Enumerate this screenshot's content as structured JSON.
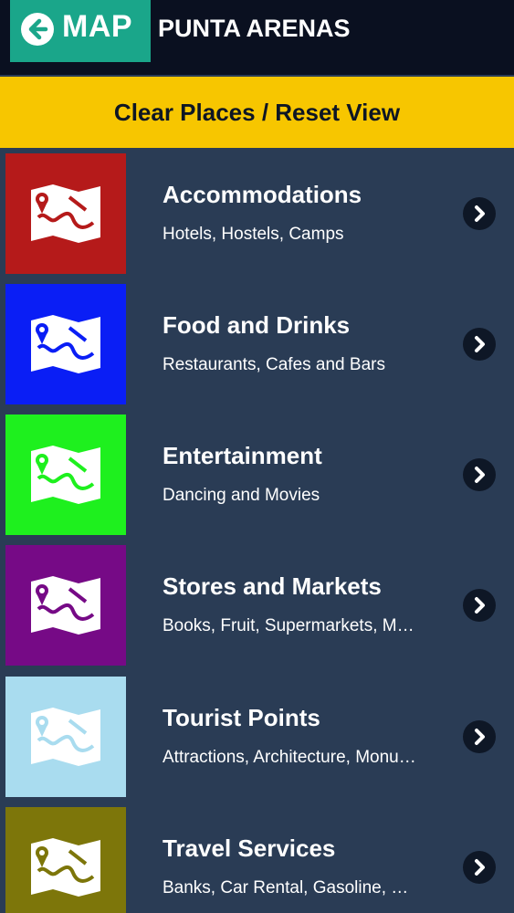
{
  "header": {
    "back_label": "MAP",
    "city": "PUNTA ARENAS",
    "back_icon": "arrow-left-icon",
    "colors": {
      "bar": "#0a1020",
      "back_button": "#1aa68a"
    }
  },
  "clear_button": {
    "label": "Clear Places / Reset View",
    "color": "#f7c600"
  },
  "categories": [
    {
      "title": "Accommodations",
      "subtitle": "Hotels, Hostels, Camps",
      "color": "#b51a1a",
      "icon": "map-icon"
    },
    {
      "title": "Food and Drinks",
      "subtitle": "Restaurants, Cafes and Bars",
      "color": "#0a1ef5",
      "icon": "map-icon"
    },
    {
      "title": "Entertainment",
      "subtitle": "Dancing and Movies",
      "color": "#1ef01e",
      "icon": "map-icon"
    },
    {
      "title": "Stores and Markets",
      "subtitle": "Books, Fruit, Supermarkets, M…",
      "color": "#760a86",
      "icon": "map-icon"
    },
    {
      "title": "Tourist Points",
      "subtitle": "Attractions, Architecture, Monu…",
      "color": "#a9dcef",
      "icon": "map-icon"
    },
    {
      "title": "Travel Services",
      "subtitle": "Banks, Car Rental, Gasoline, …",
      "color": "#7d760a",
      "icon": "map-icon"
    }
  ]
}
